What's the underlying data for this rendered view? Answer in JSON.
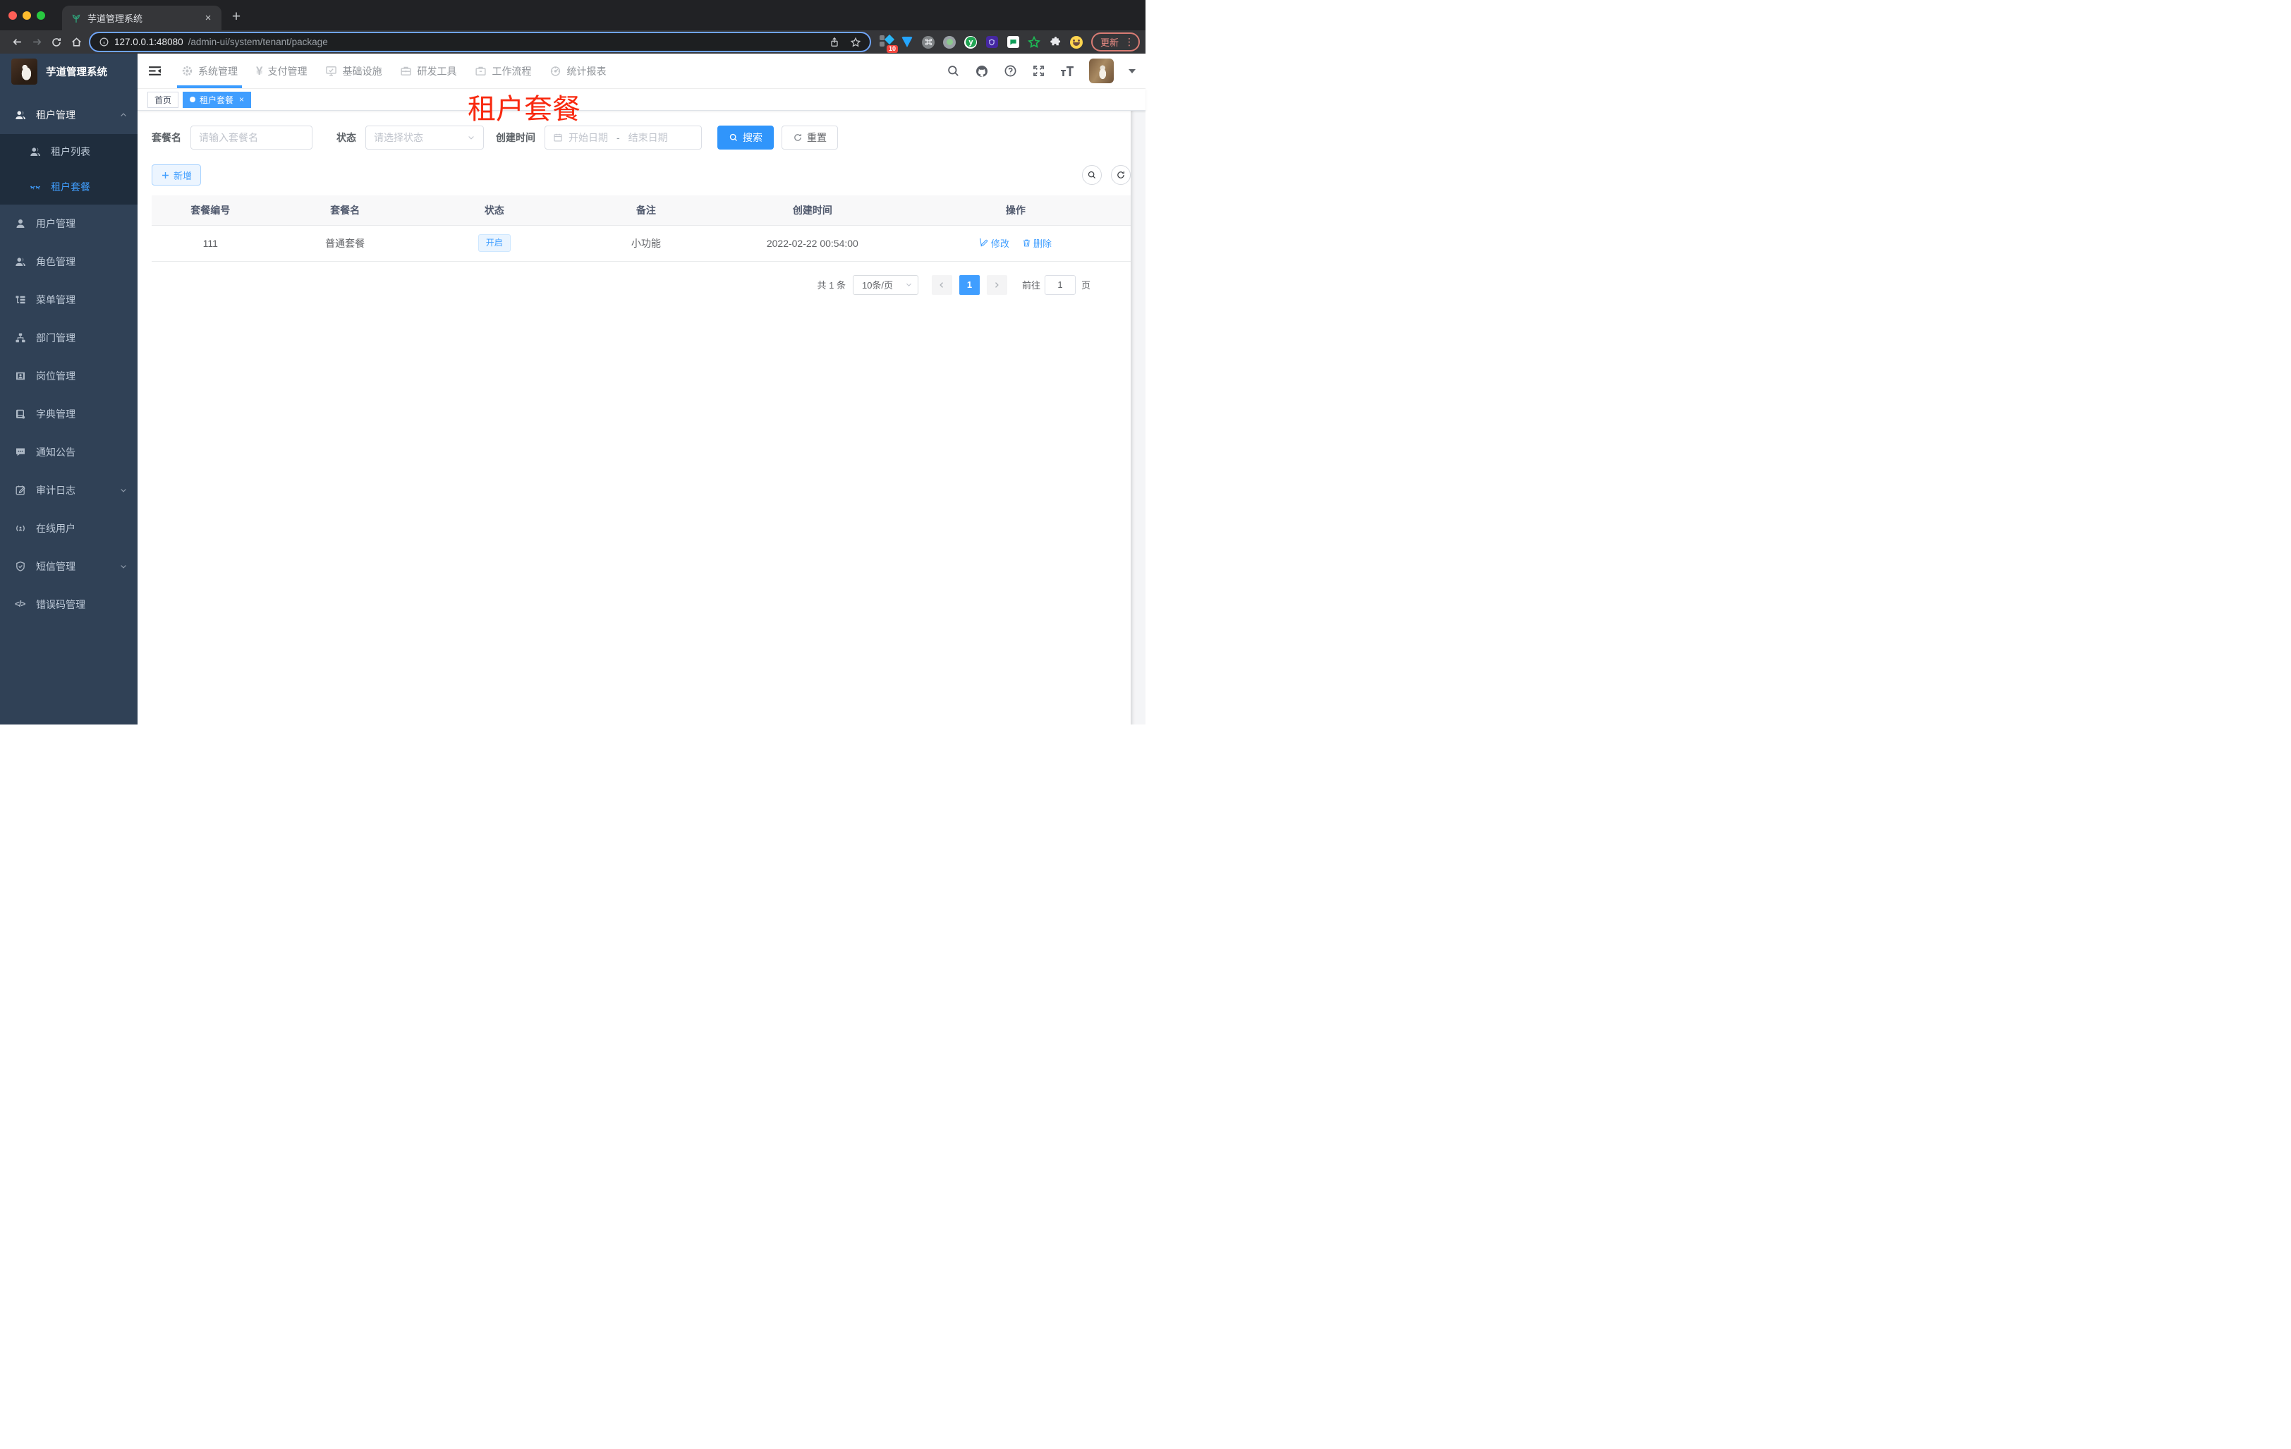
{
  "colors": {
    "accent": "#409eff",
    "sidebar_bg": "#304156",
    "submenu_bg": "#1f2d3d",
    "overlay_red": "#f8290f",
    "status_tag_bg": "#e9f4ff",
    "update_pill": "#ee8e86",
    "table_header_bg": "#f8f8f9"
  },
  "icons": {
    "close_glyph": "×",
    "new_tab_glyph": "+",
    "more_vert_glyph": "⋮",
    "yen_glyph": "¥",
    "code_glyph": "</>",
    "extension_y_glyph": "y"
  },
  "browser": {
    "tab_title": "芋道管理系统",
    "url_host": "127.0.0.1:48080",
    "url_path": "/admin-ui/system/tenant/package",
    "update_label": "更新",
    "extension_badge": "10"
  },
  "sidebar": {
    "app_title": "芋道管理系统",
    "items": [
      {
        "label": "租户管理"
      },
      {
        "label": "租户列表"
      },
      {
        "label": "租户套餐"
      },
      {
        "label": "用户管理"
      },
      {
        "label": "角色管理"
      },
      {
        "label": "菜单管理"
      },
      {
        "label": "部门管理"
      },
      {
        "label": "岗位管理"
      },
      {
        "label": "字典管理"
      },
      {
        "label": "通知公告"
      },
      {
        "label": "审计日志"
      },
      {
        "label": "在线用户"
      },
      {
        "label": "短信管理"
      },
      {
        "label": "错误码管理"
      }
    ]
  },
  "top_nav": {
    "items": [
      {
        "label": "系统管理"
      },
      {
        "label": "支付管理"
      },
      {
        "label": "基础设施"
      },
      {
        "label": "研发工具"
      },
      {
        "label": "工作流程"
      },
      {
        "label": "统计报表"
      }
    ]
  },
  "tags": {
    "home": "首页",
    "active": "租户套餐"
  },
  "overlay": {
    "page_label": "租户套餐"
  },
  "filters": {
    "name_label": "套餐名",
    "name_placeholder": "请输入套餐名",
    "status_label": "状态",
    "status_placeholder": "请选择状态",
    "date_label": "创建时间",
    "date_start_placeholder": "开始日期",
    "date_separator": "-",
    "date_end_placeholder": "结束日期",
    "search_label": "搜索",
    "reset_label": "重置"
  },
  "toolbar": {
    "add_label": "新增"
  },
  "table": {
    "columns": [
      "套餐编号",
      "套餐名",
      "状态",
      "备注",
      "创建时间",
      "操作"
    ],
    "rows": [
      {
        "id": "111",
        "name": "普通套餐",
        "status": "开启",
        "remark": "小功能",
        "created_at": "2022-02-22 00:54:00",
        "edit_label": "修改",
        "delete_label": "删除"
      }
    ]
  },
  "pagination": {
    "total": "共 1 条",
    "size": "10条/页",
    "page": "1",
    "goto_label": "前往",
    "goto_value": "1",
    "unit": "页"
  }
}
